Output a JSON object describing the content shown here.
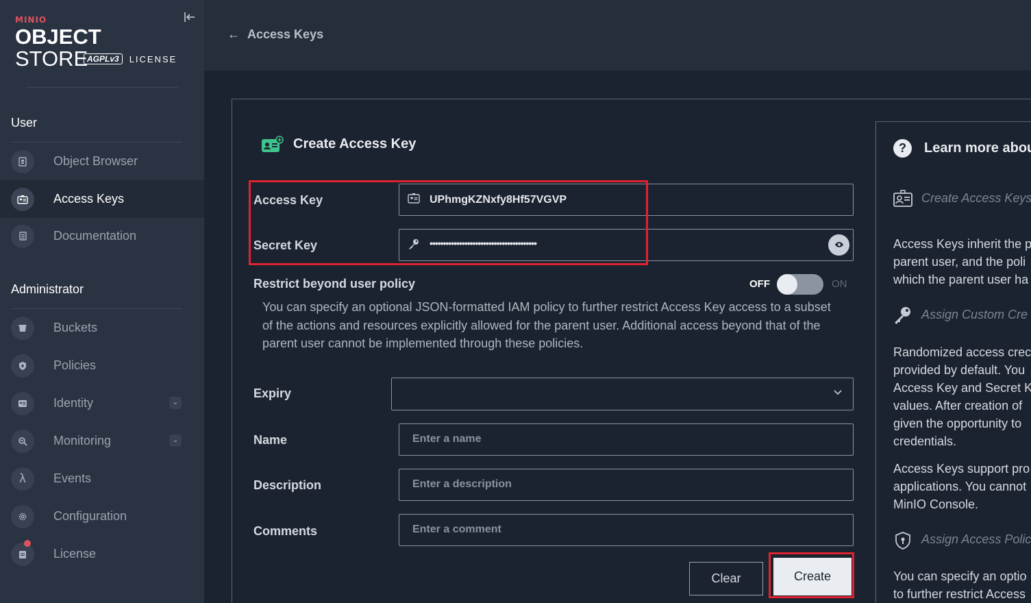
{
  "brand": {
    "maker": "MINIO",
    "product_bold": "OBJECT",
    "product_thin": "STORE",
    "agpl": "AGPLv3",
    "license_word": "LICENSE"
  },
  "sidebar": {
    "user_section": "User",
    "admin_section": "Administrator",
    "user_items": [
      {
        "label": "Object Browser",
        "icon": "object-browser-icon"
      },
      {
        "label": "Access Keys",
        "icon": "access-keys-icon"
      },
      {
        "label": "Documentation",
        "icon": "documentation-icon"
      }
    ],
    "admin_items": [
      {
        "label": "Buckets",
        "icon": "bucket-icon"
      },
      {
        "label": "Policies",
        "icon": "policy-icon"
      },
      {
        "label": "Identity",
        "icon": "identity-icon"
      },
      {
        "label": "Monitoring",
        "icon": "monitoring-icon"
      },
      {
        "label": "Events",
        "icon": "lambda-icon",
        "glyph": "λ"
      },
      {
        "label": "Configuration",
        "icon": "gear-icon"
      },
      {
        "label": "License",
        "icon": "license-icon"
      }
    ]
  },
  "header": {
    "back_arrow": "←",
    "title": "Access Keys"
  },
  "form": {
    "title": "Create Access Key",
    "access_key_label": "Access Key",
    "access_key_value": "UPhmgKZNxfy8Hf57VGVP",
    "secret_key_label": "Secret Key",
    "secret_key_value": "••••••••••••••••••••••••••••••••••••••••",
    "restrict_label": "Restrict beyond user policy",
    "toggle_off": "OFF",
    "toggle_on": "ON",
    "restrict_help": "You can specify an optional JSON-formatted IAM policy to further restrict Access Key access to a subset of the actions and resources explicitly allowed for the parent user. Additional access beyond that of the parent user cannot be implemented through these policies.",
    "expiry_label": "Expiry",
    "expiry_value": "",
    "name_label": "Name",
    "name_placeholder": "Enter a name",
    "description_label": "Description",
    "description_placeholder": "Enter a description",
    "comments_label": "Comments",
    "comments_placeholder": "Enter a comment",
    "clear_label": "Clear",
    "create_label": "Create"
  },
  "help": {
    "title": "Learn more about",
    "sub1": "Create Access Keys",
    "para1": [
      "Access Keys inherit the p",
      "parent user, and the poli",
      "which the parent user ha"
    ],
    "sub2": "Assign Custom Cre",
    "para2": [
      "Randomized access crec",
      "provided by default. You",
      "Access Key and Secret K",
      "values. After creation of",
      "given the opportunity to",
      "credentials."
    ],
    "para3": [
      "Access Keys support pro",
      "applications. You cannot",
      "MinIO Console."
    ],
    "sub3": "Assign Access Polic",
    "para4": [
      "You can specify an optio",
      "to further restrict Access"
    ]
  },
  "colors": {
    "accent_red": "#e0232f",
    "form_icon_green": "#3ec48c",
    "sidebar_bg": "#2a3342",
    "page_bg": "#1c2330"
  }
}
